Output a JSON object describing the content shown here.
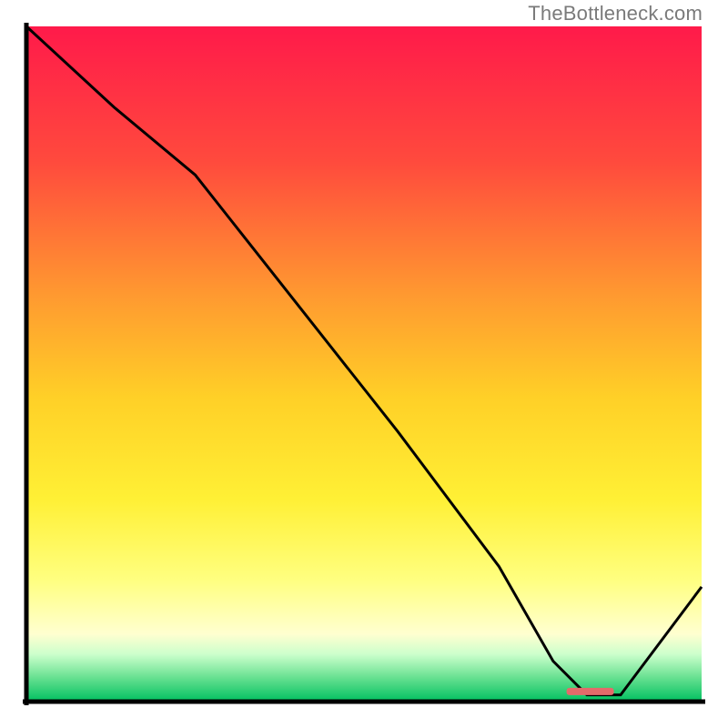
{
  "watermark": "TheBottleneck.com",
  "chart_data": {
    "type": "line",
    "title": "",
    "xlabel": "",
    "ylabel": "",
    "xlim": [
      0,
      100
    ],
    "ylim": [
      0,
      100
    ],
    "series": [
      {
        "name": "bottleneck-curve",
        "x": [
          0,
          13,
          25,
          40,
          55,
          70,
          78,
          83,
          88,
          100
        ],
        "y": [
          100,
          88,
          78,
          59,
          40,
          20,
          6,
          1,
          1,
          17
        ]
      }
    ],
    "marker": {
      "name": "optimal-segment",
      "x_start": 80,
      "x_end": 87,
      "y": 1.5,
      "color": "#e46a6a"
    },
    "axes_color": "#000000",
    "line_color": "#000000",
    "background": {
      "type": "vertical-gradient",
      "stops": [
        {
          "pos": 0.0,
          "color": "#ff1a4a"
        },
        {
          "pos": 0.2,
          "color": "#ff4a3d"
        },
        {
          "pos": 0.4,
          "color": "#ff9a30"
        },
        {
          "pos": 0.55,
          "color": "#ffd027"
        },
        {
          "pos": 0.7,
          "color": "#fff035"
        },
        {
          "pos": 0.82,
          "color": "#ffff80"
        },
        {
          "pos": 0.9,
          "color": "#ffffd0"
        },
        {
          "pos": 0.93,
          "color": "#ccffcc"
        },
        {
          "pos": 0.965,
          "color": "#66e090"
        },
        {
          "pos": 1.0,
          "color": "#00c060"
        }
      ]
    }
  }
}
